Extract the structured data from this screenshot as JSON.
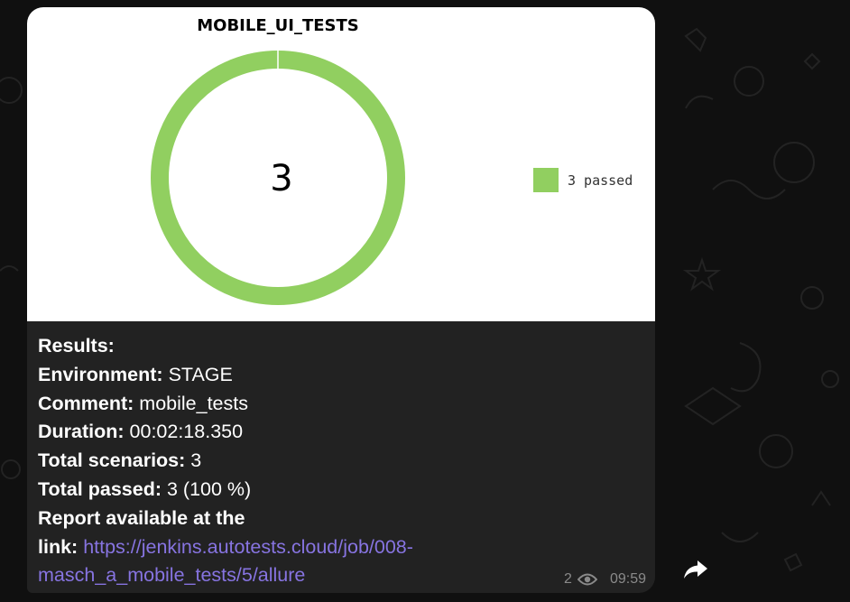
{
  "chart_data": {
    "type": "pie",
    "title": "MOBILE_UI_TESTS",
    "center_label": "3",
    "categories": [
      "passed"
    ],
    "values": [
      3
    ],
    "legend": [
      {
        "label": "3 passed",
        "color": "#91cf60"
      }
    ],
    "legend_position": "right",
    "colors": [
      "#91cf60"
    ]
  },
  "message": {
    "results_label": "Results:",
    "environment_label": "Environment:",
    "environment_value": "STAGE",
    "comment_label": "Comment:",
    "comment_value": "mobile_tests",
    "duration_label": "Duration:",
    "duration_value": "00:02:18.350",
    "scenarios_label": "Total scenarios:",
    "scenarios_value": "3",
    "passed_label": "Total passed:",
    "passed_value": "3 (100 %)",
    "report_label_1": "Report available at the",
    "report_label_2": "link:",
    "report_link_1": "https://jenkins.autotests.cloud/job/008-",
    "report_link_2": "masch_a_mobile_tests/5/allure"
  },
  "meta": {
    "views": "2",
    "time": "09:59"
  },
  "colors": {
    "bubble": "#222222",
    "link": "#8774e1",
    "meta": "#8a8a8a",
    "passed": "#91cf60"
  }
}
